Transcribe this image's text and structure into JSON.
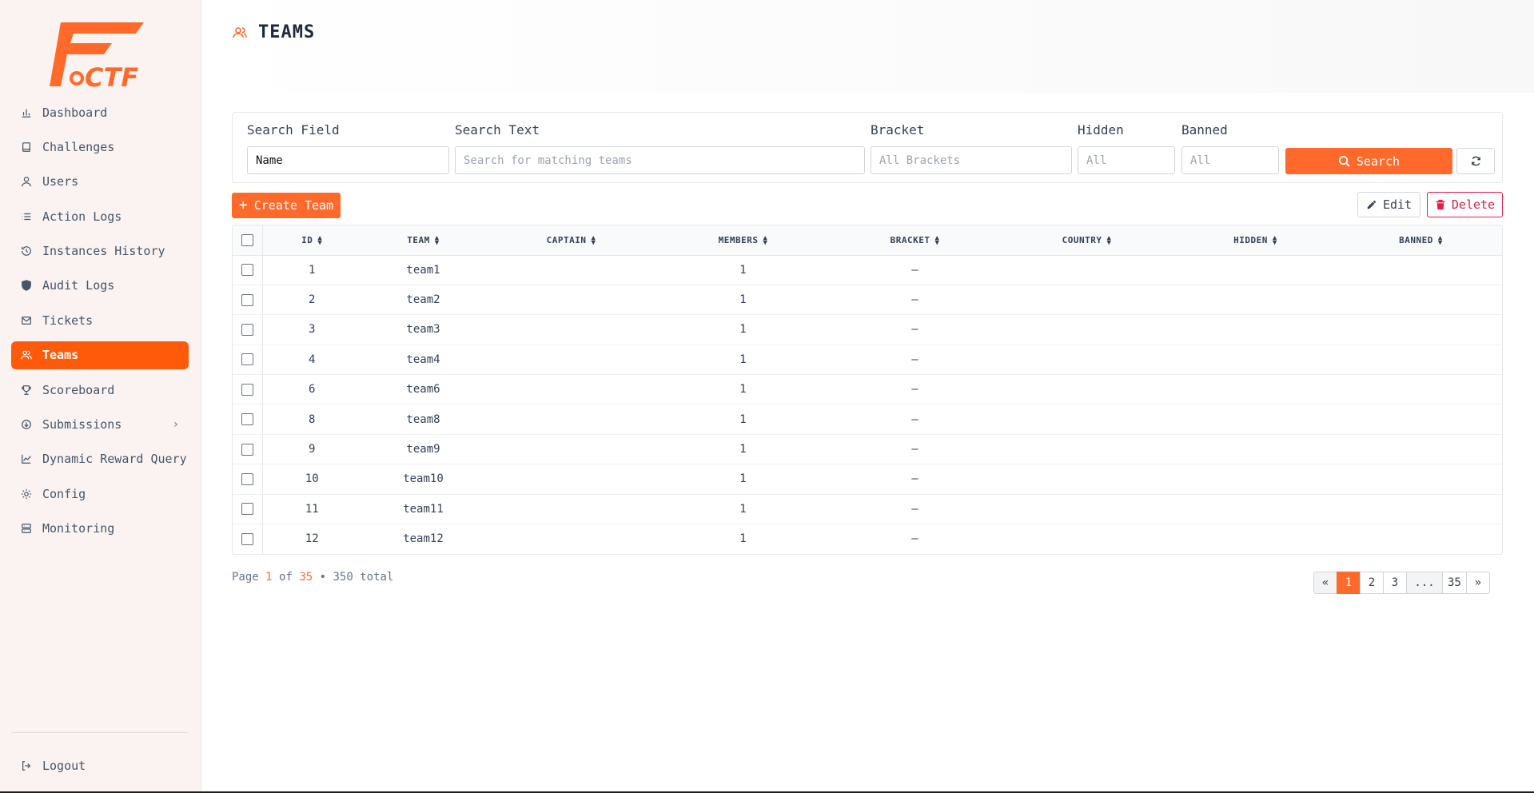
{
  "app": {
    "logo_text": "FCTF"
  },
  "sidebar": {
    "items": [
      {
        "label": "Dashboard",
        "icon": "chart-bar-icon",
        "active": false
      },
      {
        "label": "Challenges",
        "icon": "book-icon",
        "active": false
      },
      {
        "label": "Users",
        "icon": "user-icon",
        "active": false
      },
      {
        "label": "Action Logs",
        "icon": "list-icon",
        "active": false
      },
      {
        "label": "Instances History",
        "icon": "history-icon",
        "active": false
      },
      {
        "label": "Audit Logs",
        "icon": "shield-icon",
        "active": false
      },
      {
        "label": "Tickets",
        "icon": "mail-icon",
        "active": false
      },
      {
        "label": "Teams",
        "icon": "users-icon",
        "active": true
      },
      {
        "label": "Scoreboard",
        "icon": "trophy-icon",
        "active": false
      },
      {
        "label": "Submissions",
        "icon": "circle-arrow-icon",
        "active": false,
        "has_submenu": true
      },
      {
        "label": "Dynamic Reward Query",
        "icon": "line-chart-icon",
        "active": false
      },
      {
        "label": "Config",
        "icon": "gear-icon",
        "active": false
      },
      {
        "label": "Monitoring",
        "icon": "server-icon",
        "active": false
      }
    ],
    "logout_label": "Logout"
  },
  "header": {
    "title": "TEAMS"
  },
  "filters": {
    "search_field": {
      "label": "Search Field",
      "value": "Name"
    },
    "search_text": {
      "label": "Search Text",
      "placeholder": "Search for matching teams"
    },
    "bracket": {
      "label": "Bracket",
      "value": "All Brackets"
    },
    "hidden": {
      "label": "Hidden",
      "value": "All"
    },
    "banned": {
      "label": "Banned",
      "value": "All"
    },
    "search_button": "Search"
  },
  "toolbar": {
    "create_label": "Create Team",
    "edit_label": "Edit",
    "delete_label": "Delete"
  },
  "table": {
    "columns": [
      "ID",
      "TEAM",
      "CAPTAIN",
      "MEMBERS",
      "BRACKET",
      "COUNTRY",
      "HIDDEN",
      "BANNED"
    ],
    "rows": [
      {
        "id": "1",
        "team": "team1",
        "captain": "",
        "members": "1",
        "bracket": "—",
        "country": "",
        "hidden": "",
        "banned": ""
      },
      {
        "id": "2",
        "team": "team2",
        "captain": "",
        "members": "1",
        "bracket": "—",
        "country": "",
        "hidden": "",
        "banned": ""
      },
      {
        "id": "3",
        "team": "team3",
        "captain": "",
        "members": "1",
        "bracket": "—",
        "country": "",
        "hidden": "",
        "banned": ""
      },
      {
        "id": "4",
        "team": "team4",
        "captain": "",
        "members": "1",
        "bracket": "—",
        "country": "",
        "hidden": "",
        "banned": ""
      },
      {
        "id": "6",
        "team": "team6",
        "captain": "",
        "members": "1",
        "bracket": "—",
        "country": "",
        "hidden": "",
        "banned": ""
      },
      {
        "id": "8",
        "team": "team8",
        "captain": "",
        "members": "1",
        "bracket": "—",
        "country": "",
        "hidden": "",
        "banned": ""
      },
      {
        "id": "9",
        "team": "team9",
        "captain": "",
        "members": "1",
        "bracket": "—",
        "country": "",
        "hidden": "",
        "banned": ""
      },
      {
        "id": "10",
        "team": "team10",
        "captain": "",
        "members": "1",
        "bracket": "—",
        "country": "",
        "hidden": "",
        "banned": ""
      },
      {
        "id": "11",
        "team": "team11",
        "captain": "",
        "members": "1",
        "bracket": "—",
        "country": "",
        "hidden": "",
        "banned": ""
      },
      {
        "id": "12",
        "team": "team12",
        "captain": "",
        "members": "1",
        "bracket": "—",
        "country": "",
        "hidden": "",
        "banned": ""
      }
    ]
  },
  "pagination": {
    "page_word": "Page",
    "current": "1",
    "of_word": "of",
    "total_pages": "35",
    "separator": "•",
    "total_text": "350 total",
    "buttons": [
      "«",
      "1",
      "2",
      "3",
      "...",
      "35",
      "»"
    ]
  },
  "colors": {
    "accent": "#ff5a0a",
    "danger": "#e11d48",
    "sidebar_bg": "#faf3f1"
  }
}
